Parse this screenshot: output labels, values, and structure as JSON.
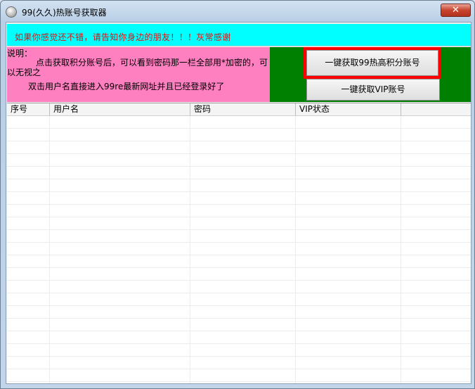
{
  "window": {
    "title": "99(久久)热账号获取器",
    "close_label": "✕"
  },
  "banner": {
    "text": "如果你感觉还不错，请告知你身边的朋友！！！灰常感谢"
  },
  "instructions": {
    "label": "说明：",
    "line1": "点击获取积分账号后，可以看到密码那一栏全部用*加密的，可",
    "line2": "以无视之",
    "line3": "双击用户名直接进入99re最新网址并且已经登录好了"
  },
  "buttons": {
    "get_99_points": "一键获取99热高积分账号",
    "get_vip": "一键获取VIP账号"
  },
  "table": {
    "columns": [
      "序号",
      "用户名",
      "密码",
      "VIP状态",
      ""
    ],
    "rows": []
  },
  "colors": {
    "banner_bg": "#00ffff",
    "banner_text": "#e01010",
    "info_bg": "#ff80c0",
    "button_panel_bg": "#008000",
    "highlight": "#ff0000"
  }
}
